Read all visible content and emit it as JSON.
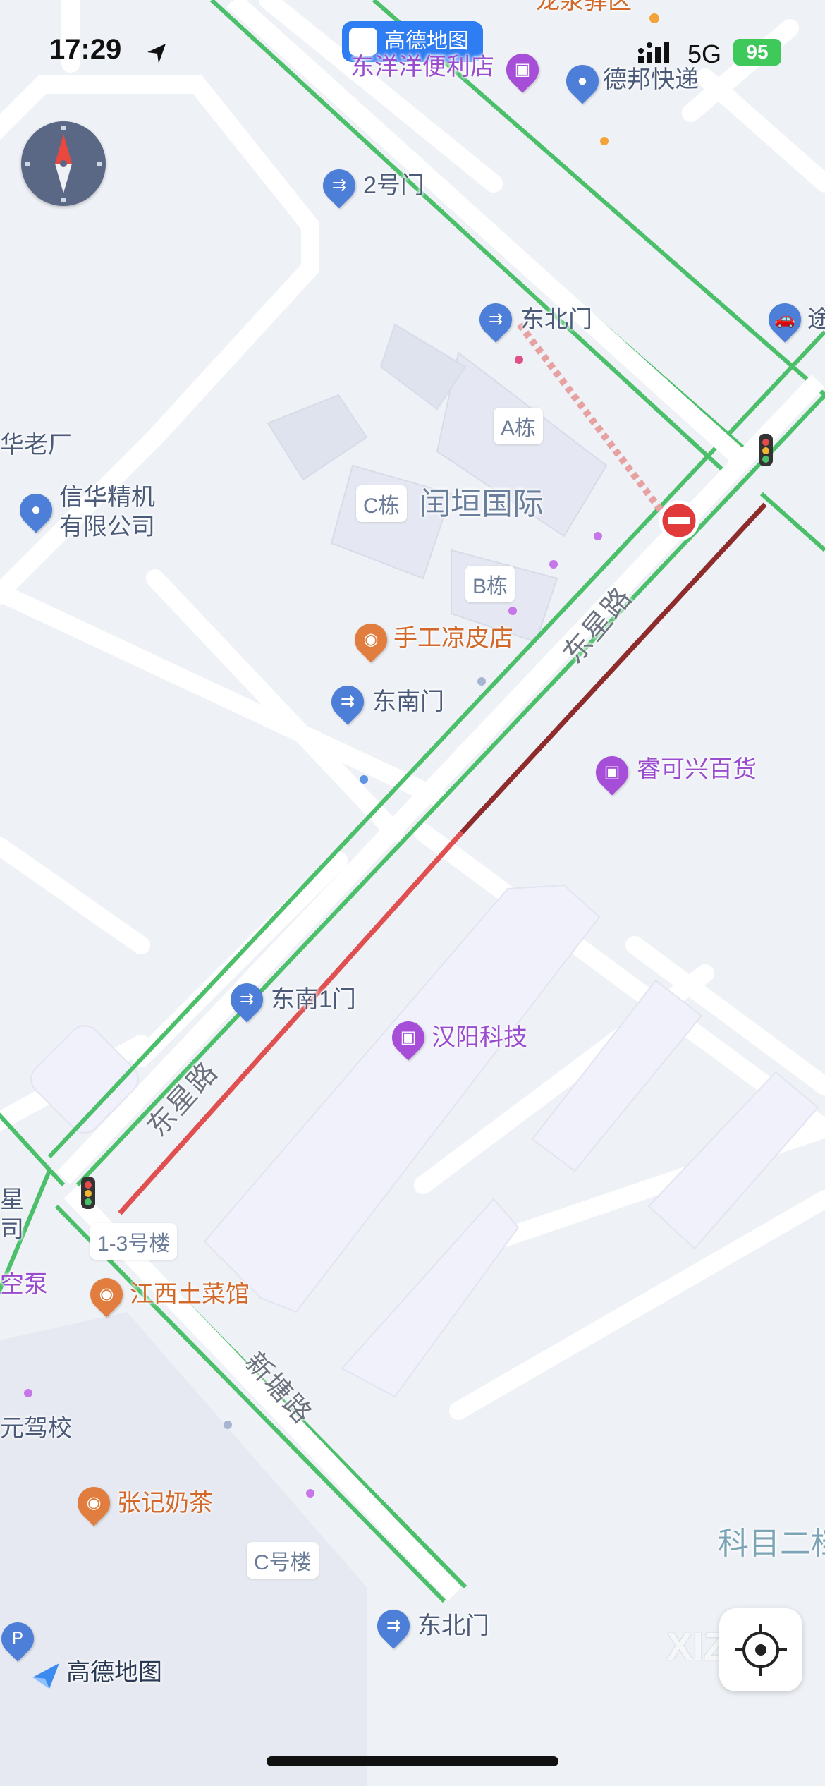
{
  "status_bar": {
    "time": "17:29",
    "app_name": "高德地图",
    "network": "5G",
    "battery": "95"
  },
  "map": {
    "colors": {
      "road_green": "#4bbf6a",
      "road_red": "#e05050",
      "road_darkred": "#8e2c2c",
      "base": "#eef1f6",
      "building": "#f2f2fb"
    },
    "road_labels": {
      "dongxing_top": "东星路",
      "dongxing_bottom": "东星路",
      "xintang": "新塘路"
    },
    "pois": {
      "dongyang_store": "东洋洋便利店",
      "debang": "德邦快递",
      "gate_2": "2号门",
      "gate_north_east": "东北门",
      "tu_label": "途",
      "xinhua_1": "信华精机",
      "xinhua_2": "有限公司",
      "old_factory": "华老厂",
      "runyuan": "闰垣国际",
      "building_a": "A栋",
      "building_b": "B栋",
      "building_c": "C栋",
      "liangpi": "手工凉皮店",
      "gate_south_east": "东南门",
      "ruikexing": "睿可兴百货",
      "gate_south_east_1": "东南1门",
      "hanyang": "汉阳科技",
      "building_13": "1-3号楼",
      "jiangxi": "江西土菜馆",
      "partial_xing": "星",
      "partial_si": "司",
      "partial_beng": "空泵",
      "driving_school": "元驾校",
      "zhangji": "张记奶茶",
      "building_c_lou": "C号楼",
      "gate_north_east_2": "东北门",
      "kemu": "科目二档",
      "top_partial": "龙泉驿区",
      "logo_text": "高德地图",
      "watermark": "XIZI"
    }
  }
}
